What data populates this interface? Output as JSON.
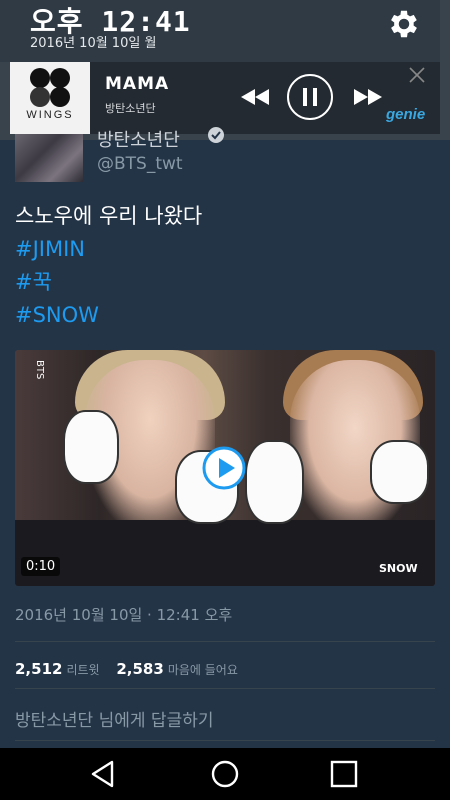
{
  "status": {
    "time": "오후 12:41",
    "date": "2016년 10월 10일 월"
  },
  "notification": {
    "album_label": "WINGS",
    "song": "MAMA",
    "artist": "방탄소년단",
    "app": "genie"
  },
  "tweet": {
    "author_name": "방탄소년단",
    "handle": "@BTS_twt",
    "text": "스노우에 우리 나왔다",
    "hashtags": [
      "#JIMIN",
      "#꾹",
      "#SNOW"
    ],
    "video_duration": "0:10",
    "video_sticker_brand": "SNOW",
    "video_watermark": "BTS",
    "timestamp": "2016년 10월 10일 · 12:41 오후",
    "retweets": "2,512",
    "retweets_label": "리트윗",
    "likes": "2,583",
    "likes_label": "마음에 들어요",
    "reply_placeholder": "방탄소년단 님에게 답글하기"
  },
  "colors": {
    "background": "#243447",
    "hashtag": "#1d9bf0",
    "muted": "#8899a6",
    "brand": "#3aa8e0"
  },
  "icons": {
    "settings": "gear-icon",
    "rewind": "rewind-icon",
    "pause": "pause-icon",
    "fast_forward": "fast-forward-icon",
    "close": "close-icon",
    "verified": "verified-badge-icon",
    "play": "play-icon",
    "back": "back-icon",
    "home": "home-icon",
    "recents": "recents-icon"
  }
}
